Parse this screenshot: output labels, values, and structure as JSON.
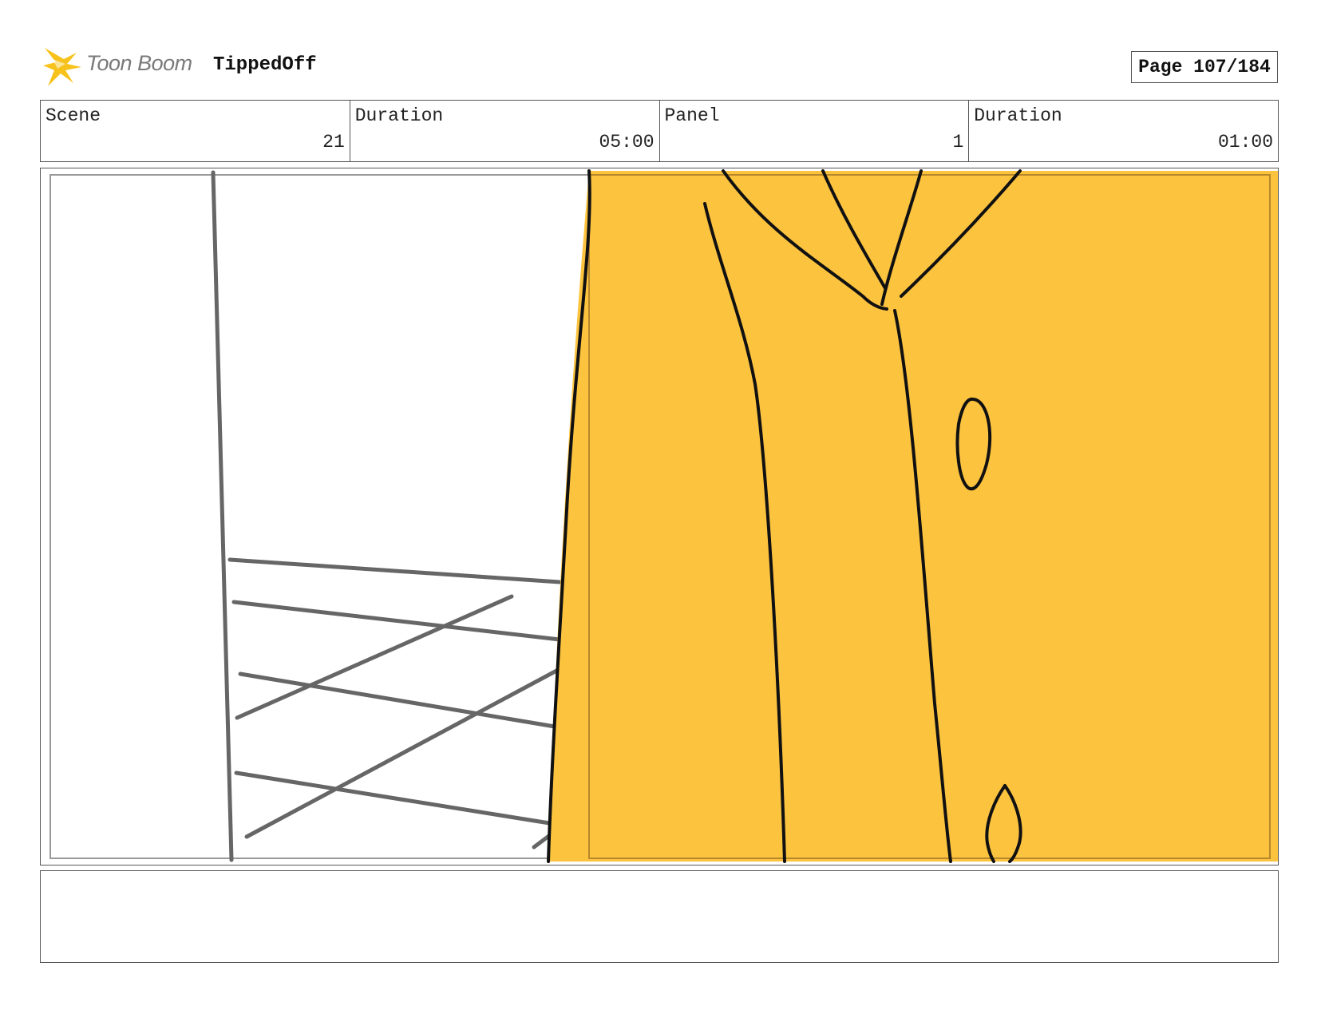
{
  "header": {
    "logo_text": "Toon Boom",
    "project_title": "TippedOff",
    "page_label": "Page 107/184"
  },
  "info": {
    "scene_label": "Scene",
    "scene_value": "21",
    "scene_duration_label": "Duration",
    "scene_duration_value": "05:00",
    "panel_label": "Panel",
    "panel_value": "1",
    "panel_duration_label": "Duration",
    "panel_duration_value": "01:00"
  },
  "colors": {
    "accent_yellow": "#FCC33F",
    "ink": "#111111",
    "sketch_gray": "#666666",
    "logo_yellow": "#F6C21B",
    "frame_border": "#555555"
  },
  "icons": {
    "logo": "toon-boom-starburst-icon"
  },
  "notes": {
    "text": ""
  }
}
